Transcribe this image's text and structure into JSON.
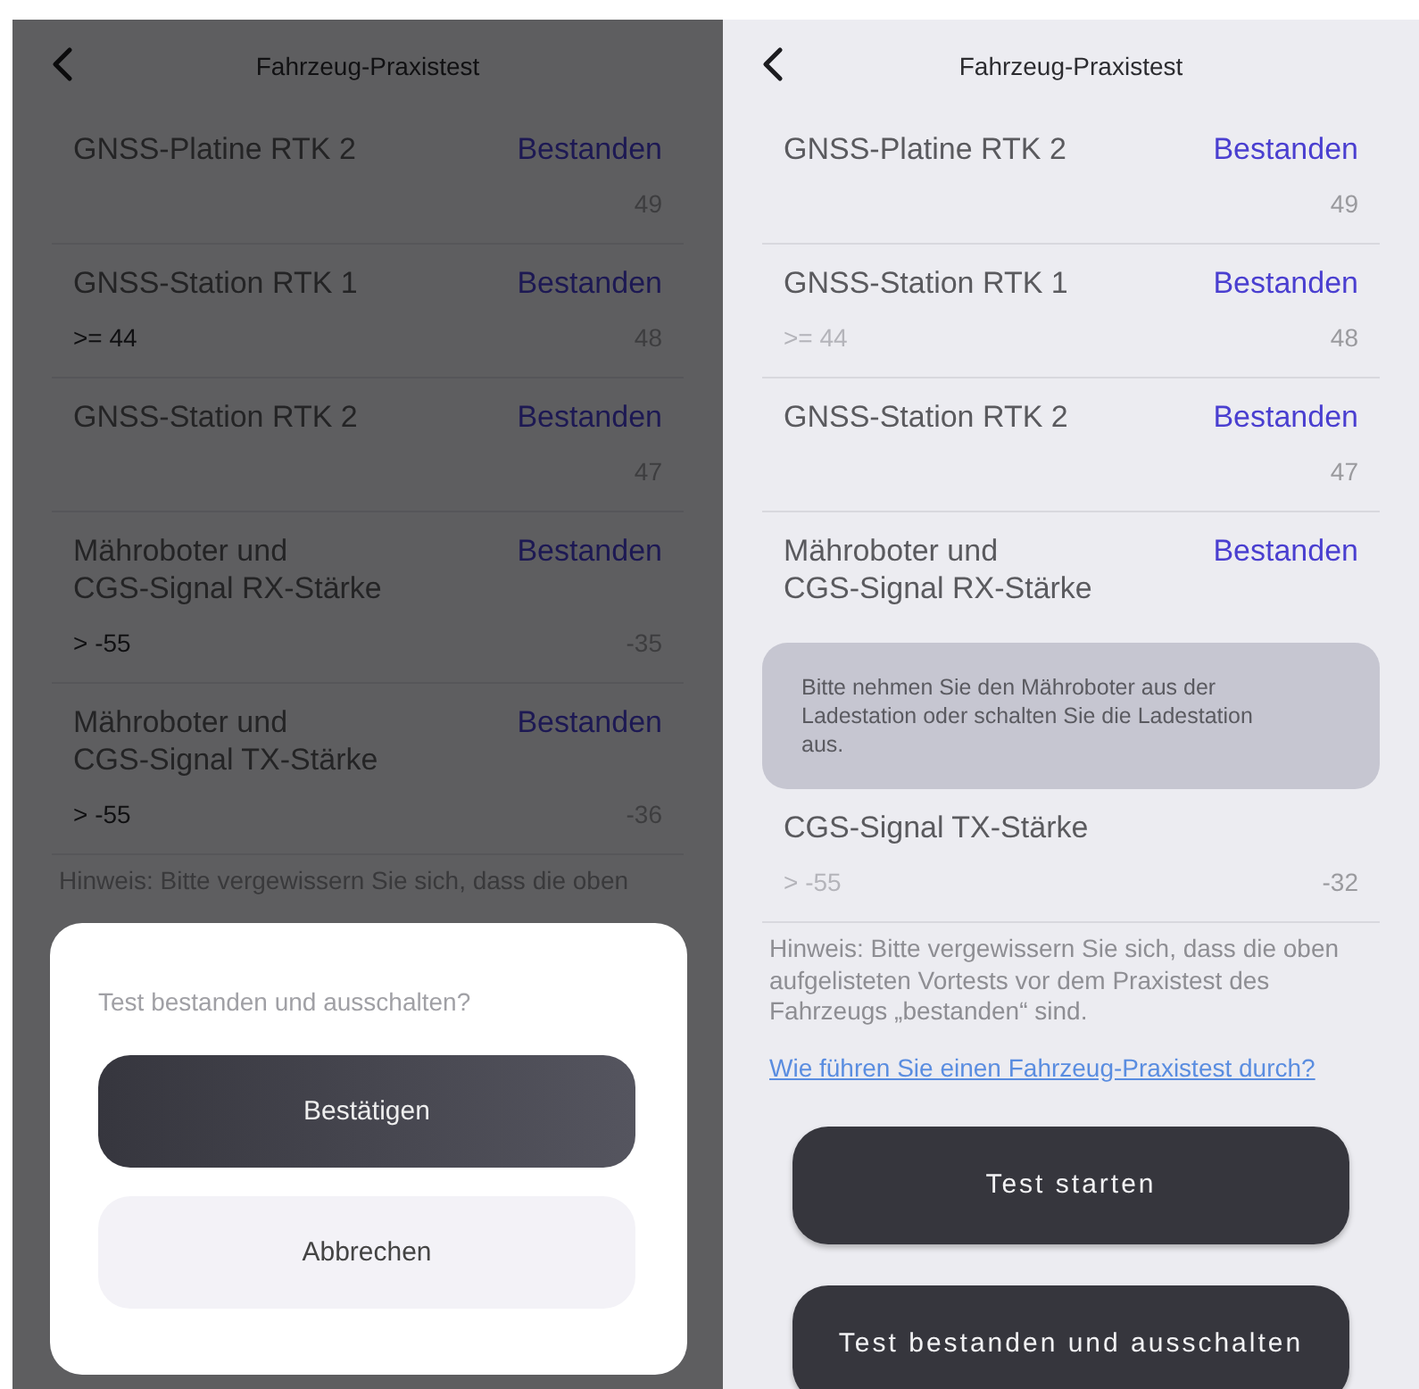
{
  "screens": [
    {
      "dimmed": true,
      "header": {
        "title": "Fahrzeug-Praxistest"
      },
      "items": [
        {
          "kind": "row",
          "title_lines": [
            "GNSS-Platine RTK 2"
          ],
          "status": "Bestanden",
          "reading": "49"
        },
        {
          "kind": "row",
          "title_lines": [
            "GNSS-Station RTK 1"
          ],
          "status": "Bestanden",
          "threshold": ">= 44",
          "reading": "48"
        },
        {
          "kind": "row",
          "title_lines": [
            "GNSS-Station RTK 2"
          ],
          "status": "Bestanden",
          "reading": "47"
        },
        {
          "kind": "row",
          "title_lines": [
            "Mähroboter und",
            "CGS-Signal RX-Stärke"
          ],
          "status": "Bestanden",
          "threshold": "> -55",
          "reading": "-35"
        },
        {
          "kind": "row",
          "title_lines": [
            "Mähroboter und",
            "CGS-Signal TX-Stärke"
          ],
          "status": "Bestanden",
          "threshold": "> -55",
          "reading": "-36"
        }
      ],
      "hint": "Hinweis: Bitte vergewissern Sie sich, dass die oben",
      "dialog": {
        "message": "Test bestanden und ausschalten?",
        "confirm": "Bestätigen",
        "cancel": "Abbrechen"
      }
    },
    {
      "dimmed": false,
      "header": {
        "title": "Fahrzeug-Praxistest"
      },
      "items": [
        {
          "kind": "row",
          "title_lines": [
            "GNSS-Platine RTK 2"
          ],
          "status": "Bestanden",
          "reading": "49"
        },
        {
          "kind": "row",
          "title_lines": [
            "GNSS-Station RTK 1"
          ],
          "status": "Bestanden",
          "threshold": ">= 44",
          "reading": "48"
        },
        {
          "kind": "row",
          "title_lines": [
            "GNSS-Station RTK 2"
          ],
          "status": "Bestanden",
          "reading": "47"
        },
        {
          "kind": "row",
          "title_lines": [
            "Mähroboter und",
            "CGS-Signal RX-Stärke"
          ],
          "status": "Bestanden"
        },
        {
          "kind": "toast",
          "text": "Bitte nehmen Sie den Mähroboter aus der Ladestation oder schalten Sie die Ladestation aus."
        },
        {
          "kind": "partial_row",
          "title_lines": [
            "CGS-Signal TX-Stärke"
          ],
          "threshold": "> -55",
          "reading": "-32"
        }
      ],
      "hint": "Hinweis: Bitte vergewissern Sie sich, dass die oben aufgelisteten Vortests vor dem Praxistest des Fahrzeugs „bestanden“ sind.",
      "link": "Wie führen Sie einen Fahrzeug-Praxistest durch?",
      "buttons": [
        "Test starten",
        "Test bestanden und ausschalten"
      ]
    }
  ]
}
